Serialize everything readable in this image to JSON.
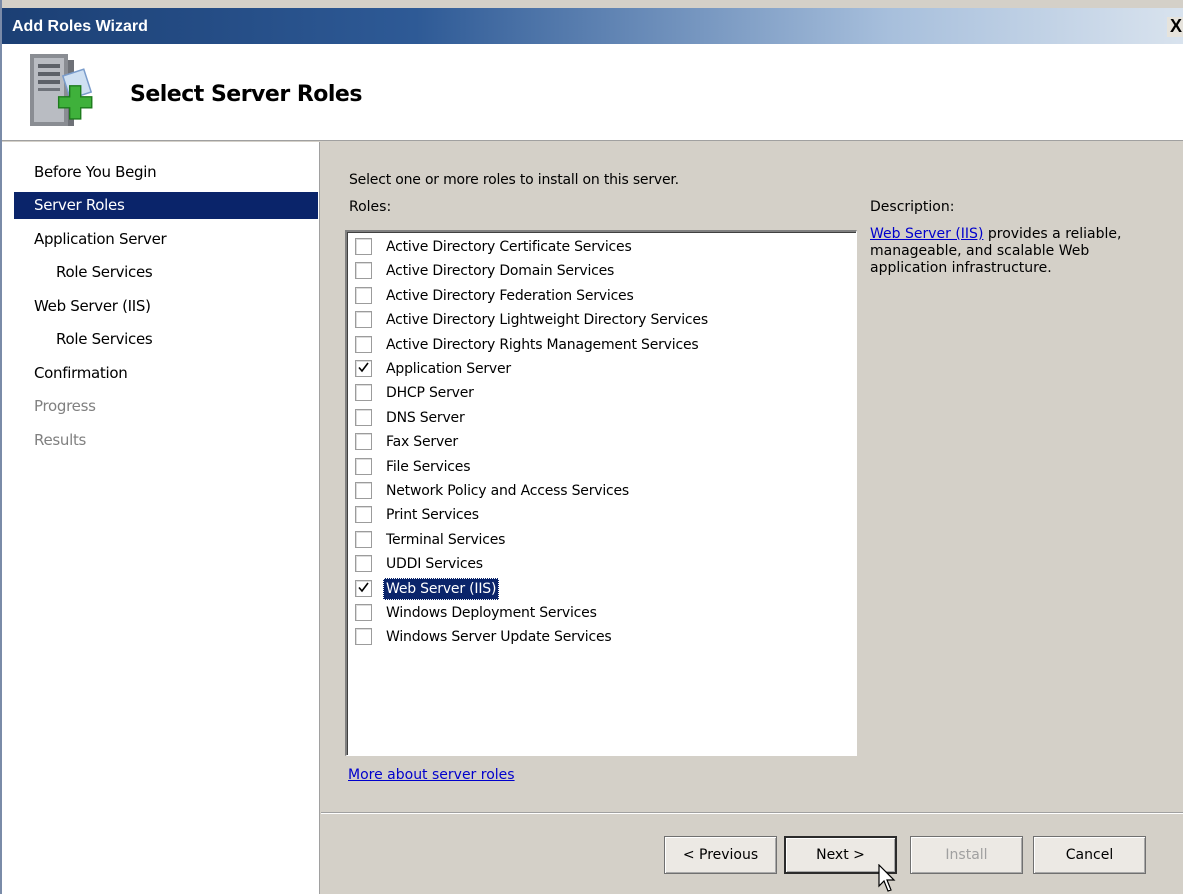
{
  "window": {
    "title": "Add Roles Wizard",
    "close_label": "X"
  },
  "header": {
    "title": "Select Server Roles",
    "icon": "server-add-icon"
  },
  "nav": {
    "items": [
      {
        "label": "Before You Begin",
        "state": "normal"
      },
      {
        "label": "Server Roles",
        "state": "selected"
      },
      {
        "label": "Application Server",
        "state": "normal"
      },
      {
        "label": "Role Services",
        "state": "normal"
      },
      {
        "label": "Web Server (IIS)",
        "state": "normal"
      },
      {
        "label": "Role Services",
        "state": "normal"
      },
      {
        "label": "Confirmation",
        "state": "normal"
      },
      {
        "label": "Progress",
        "state": "disabled"
      },
      {
        "label": "Results",
        "state": "disabled"
      }
    ]
  },
  "main": {
    "instruction": "Select one or more roles to install on this server.",
    "roles_label": "Roles:",
    "roles": [
      {
        "label": "Active Directory Certificate Services",
        "checked": false
      },
      {
        "label": "Active Directory Domain Services",
        "checked": false
      },
      {
        "label": "Active Directory Federation Services",
        "checked": false
      },
      {
        "label": "Active Directory Lightweight Directory Services",
        "checked": false
      },
      {
        "label": "Active Directory Rights Management Services",
        "checked": false
      },
      {
        "label": "Application Server",
        "checked": true
      },
      {
        "label": "DHCP Server",
        "checked": false
      },
      {
        "label": "DNS Server",
        "checked": false
      },
      {
        "label": "Fax Server",
        "checked": false
      },
      {
        "label": "File Services",
        "checked": false
      },
      {
        "label": "Network Policy and Access Services",
        "checked": false
      },
      {
        "label": "Print Services",
        "checked": false
      },
      {
        "label": "Terminal Services",
        "checked": false
      },
      {
        "label": "UDDI Services",
        "checked": false
      },
      {
        "label": "Web Server (IIS)",
        "checked": true,
        "highlighted": true
      },
      {
        "label": "Windows Deployment Services",
        "checked": false
      },
      {
        "label": "Windows Server Update Services",
        "checked": false
      }
    ],
    "description_label": "Description:",
    "description_link": "Web Server (IIS)",
    "description_text": " provides a reliable, manageable, and scalable Web application infrastructure.",
    "more_link": "More about server roles"
  },
  "buttons": {
    "previous": "< Previous",
    "next": "Next >",
    "install": "Install",
    "cancel": "Cancel"
  },
  "colors": {
    "selection": "#0a246a",
    "dialog_bg": "#d4d0c8",
    "link": "#0000cc"
  }
}
